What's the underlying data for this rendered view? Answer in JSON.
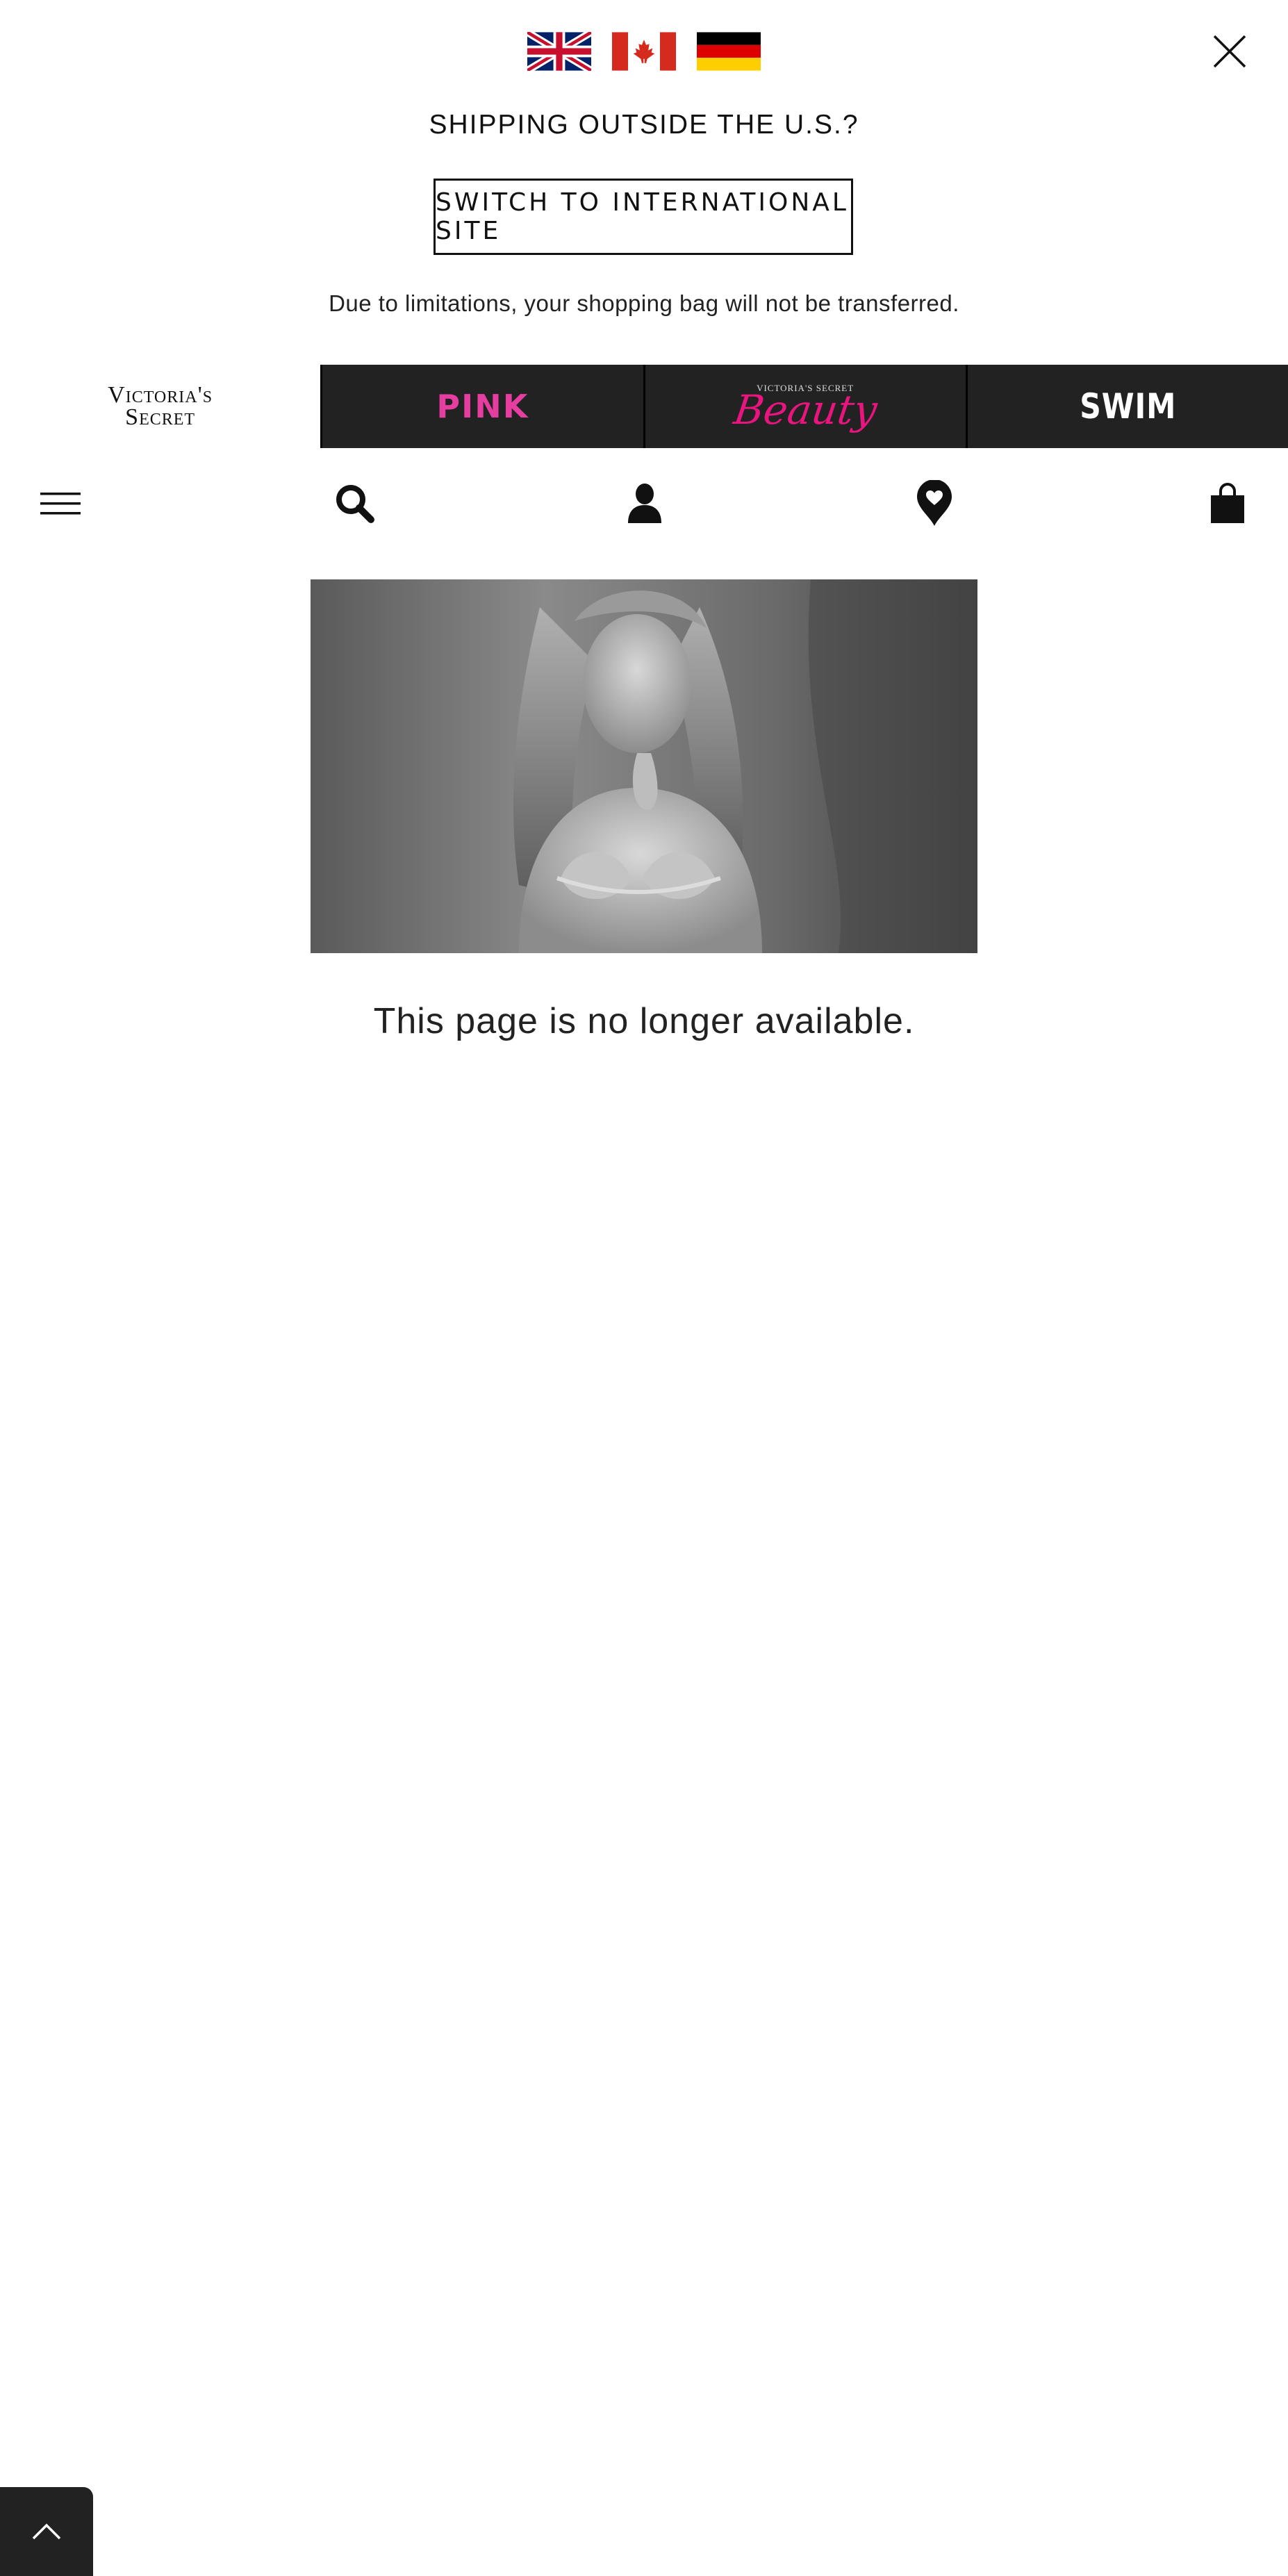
{
  "banner": {
    "flags": [
      "uk-flag-icon",
      "canada-flag-icon",
      "germany-flag-icon"
    ],
    "title": "SHIPPING OUTSIDE THE U.S.?",
    "switch_label": "SWITCH TO INTERNATIONAL SITE",
    "note": "Due to limitations, your shopping bag will not be transferred."
  },
  "brands": {
    "vs_line1": "Victoria's",
    "vs_line2": "Secret",
    "pink": "PINK",
    "beauty_small": "VICTORIA'S SECRET",
    "beauty_script": "Beauty",
    "swim": "SWIM"
  },
  "nav_icons": [
    "menu-icon",
    "search-icon",
    "account-icon",
    "favorites-icon",
    "shopping-bag-icon"
  ],
  "main": {
    "message": "This page is no longer available."
  },
  "colors": {
    "pink": "#e53ea0",
    "beauty": "#e8157f",
    "dark_tab": "#222222"
  }
}
